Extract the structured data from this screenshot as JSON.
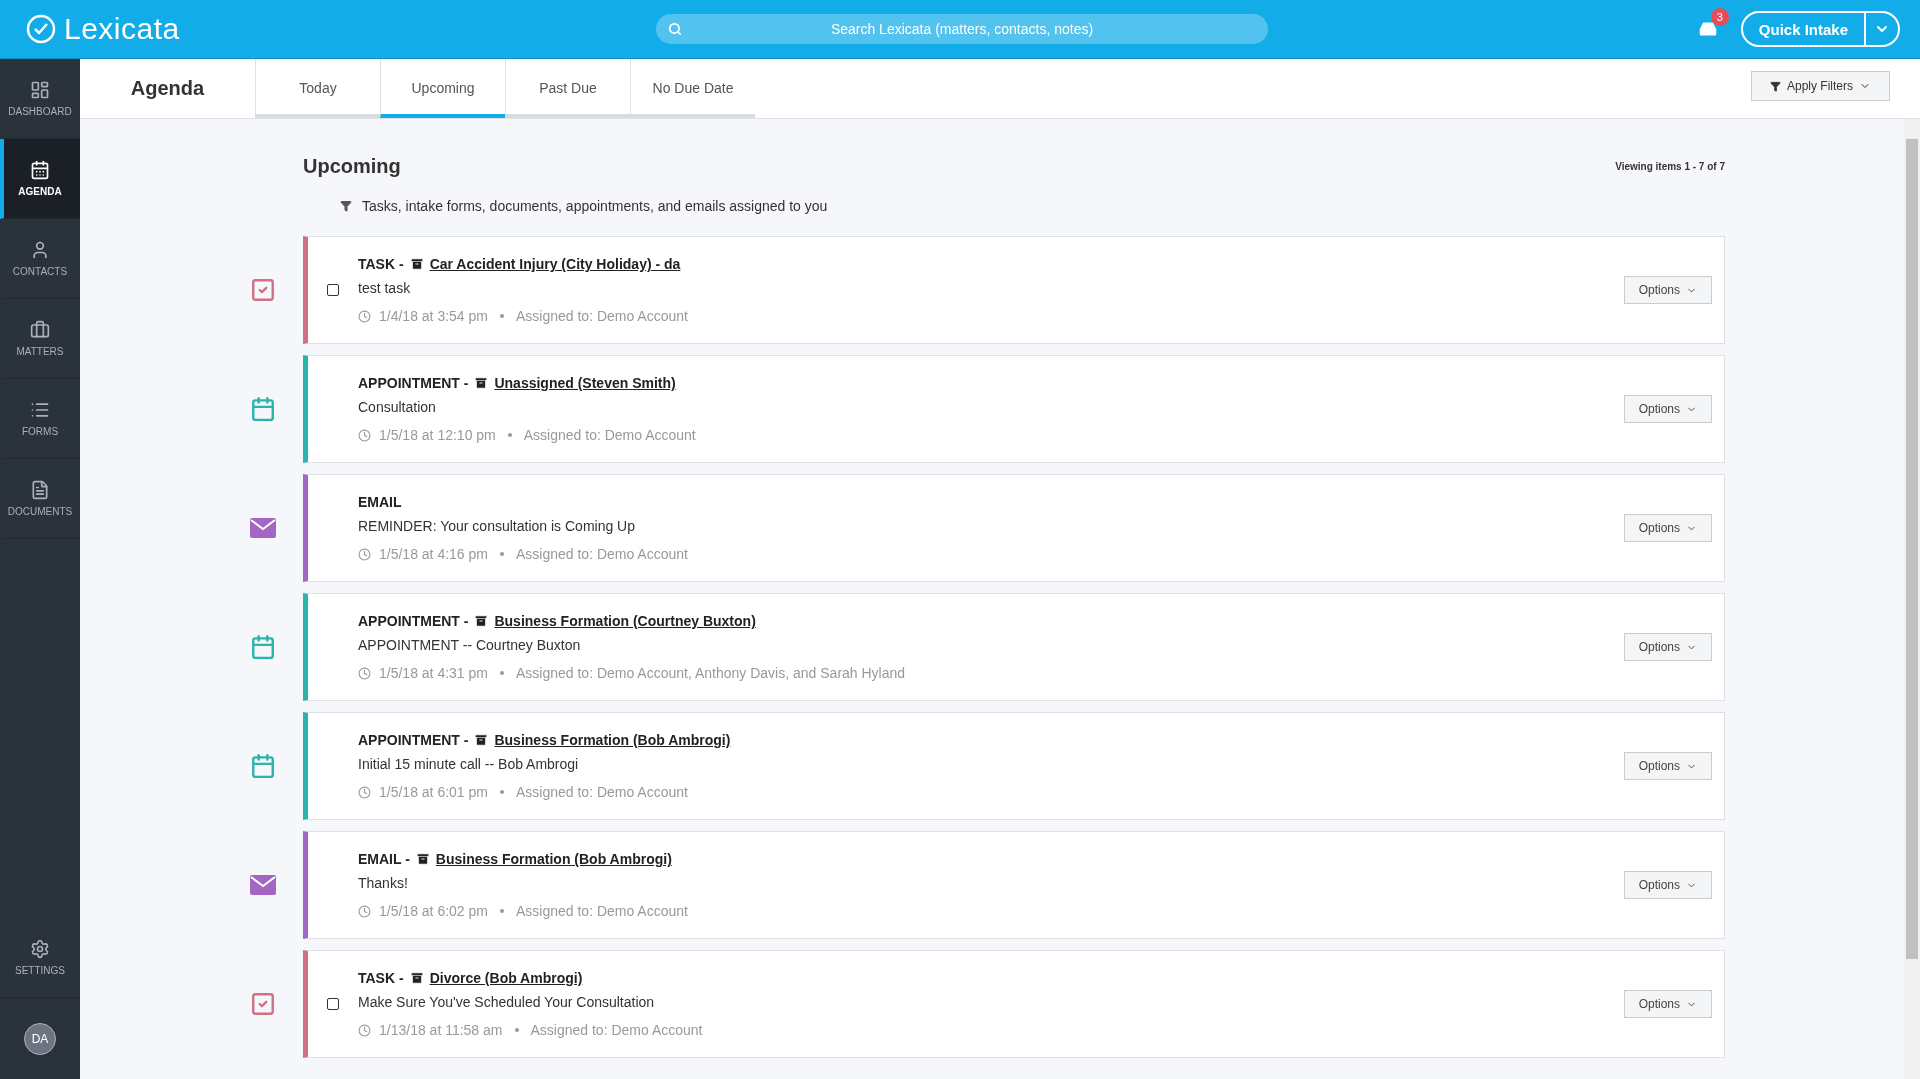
{
  "topbar": {
    "logo": "Lexicata",
    "search": {
      "placeholder": "Search Lexicata (matters, contacts, notes)"
    },
    "notifications": {
      "count": "3"
    },
    "quick_intake": "Quick Intake"
  },
  "sidebar": {
    "items": [
      {
        "label": "DASHBOARD",
        "selected": false
      },
      {
        "label": "AGENDA",
        "selected": true
      },
      {
        "label": "CONTACTS",
        "selected": false
      },
      {
        "label": "MATTERS",
        "selected": false
      },
      {
        "label": "FORMS",
        "selected": false
      },
      {
        "label": "DOCUMENTS",
        "selected": false
      }
    ],
    "settings": "SETTINGS",
    "avatar": "DA"
  },
  "header": {
    "title": "Agenda",
    "tabs": [
      {
        "label": "Today",
        "selected": false
      },
      {
        "label": "Upcoming",
        "selected": true
      },
      {
        "label": "Past Due",
        "selected": false
      },
      {
        "label": "No Due Date",
        "selected": false
      }
    ],
    "filter_button": "Apply Filters"
  },
  "list": {
    "title": "Upcoming",
    "count": "Viewing items 1 - 7 of 7",
    "description": "Tasks, intake forms, documents, appointments, and emails assigned to you",
    "items": [
      {
        "kind": "task",
        "type": "TASK -",
        "matter": "Car Accident Injury (City Holiday) - da",
        "subject": "test task",
        "checked": false,
        "time": "1/4/18 at 3:54 pm",
        "assigned": "Assigned to: Demo Account",
        "options": "Options"
      },
      {
        "kind": "appointment",
        "type": "APPOINTMENT -",
        "matter": "Unassigned (Steven Smith)",
        "subject": "Consultation",
        "time": "1/5/18 at 12:10 pm",
        "assigned": "Assigned to: Demo Account",
        "options": "Options"
      },
      {
        "kind": "email",
        "type": "EMAIL",
        "subject": "REMINDER: Your consultation is Coming Up",
        "time": "1/5/18 at 4:16 pm",
        "assigned": "Assigned to: Demo Account",
        "options": "Options"
      },
      {
        "kind": "appointment",
        "type": "APPOINTMENT -",
        "matter": "Business Formation (Courtney Buxton)",
        "subject": "APPOINTMENT -- Courtney Buxton",
        "time": "1/5/18 at 4:31 pm",
        "assigned": "Assigned to: Demo Account, Anthony Davis, and Sarah Hyland",
        "options": "Options"
      },
      {
        "kind": "appointment",
        "type": "APPOINTMENT -",
        "matter": "Business Formation (Bob Ambrogi)",
        "subject": "Initial 15 minute call -- Bob Ambrogi",
        "time": "1/5/18 at 6:01 pm",
        "assigned": "Assigned to: Demo Account",
        "options": "Options"
      },
      {
        "kind": "email",
        "type": "EMAIL -",
        "matter": "Business Formation (Bob Ambrogi)",
        "subject": "Thanks!",
        "time": "1/5/18 at 6:02 pm",
        "assigned": "Assigned to: Demo Account",
        "options": "Options"
      },
      {
        "kind": "task",
        "type": "TASK -",
        "matter": "Divorce (Bob Ambrogi)",
        "subject": "Make Sure You've Scheduled Your Consultation",
        "checked": false,
        "time": "1/13/18 at 11:58 am",
        "assigned": "Assigned to: Demo Account",
        "options": "Options"
      }
    ]
  }
}
